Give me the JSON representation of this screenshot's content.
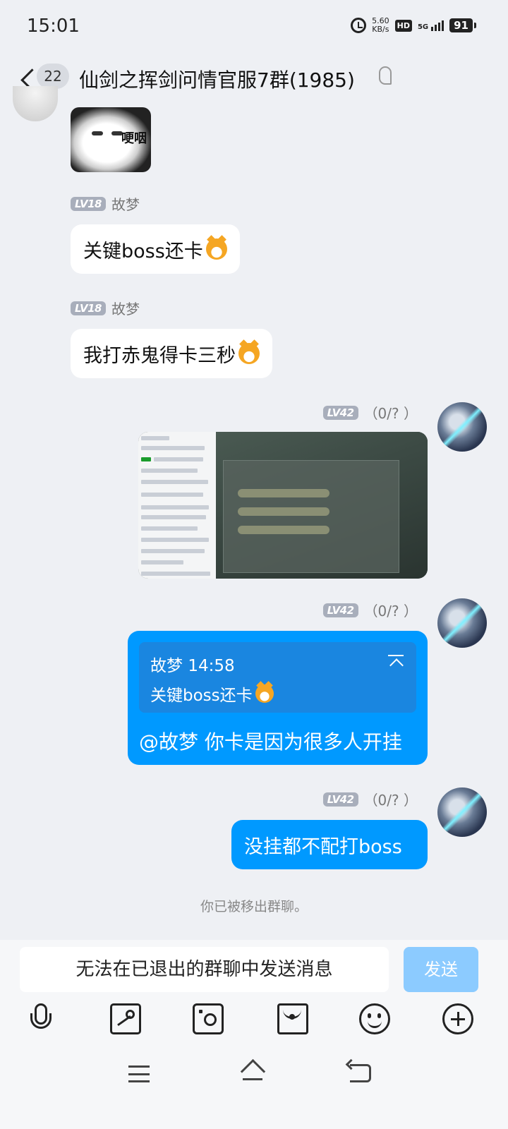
{
  "status_bar": {
    "time": "15:01",
    "net_speed_value": "5.60",
    "net_speed_unit": "KB/s",
    "hd": "HD",
    "network": "5G",
    "battery": "91"
  },
  "header": {
    "unread_count": "22",
    "title": "仙剑之挥剑问情官服7群(1985)"
  },
  "messages": [
    {
      "type": "sticker",
      "direction": "incoming",
      "sticker_text": "哽咽"
    },
    {
      "type": "text",
      "direction": "incoming",
      "level": "LV18",
      "sender": "故梦",
      "text": "关键boss还卡"
    },
    {
      "type": "text",
      "direction": "incoming",
      "level": "LV18",
      "sender": "故梦",
      "text": "我打赤鬼得卡三秒"
    },
    {
      "type": "image",
      "direction": "outgoing",
      "level": "LV42",
      "read_status": "（0/? ）"
    },
    {
      "type": "reply",
      "direction": "outgoing",
      "level": "LV42",
      "read_status": "（0/? ）",
      "quote": {
        "sender": "故梦",
        "time": "14:58",
        "text": "关键boss还卡"
      },
      "text": "@故梦 你卡是因为很多人开挂"
    },
    {
      "type": "text",
      "direction": "outgoing",
      "level": "LV42",
      "read_status": "（0/? ）",
      "text": "没挂都不配打boss"
    }
  ],
  "system_notice": "你已被移出群聊。",
  "input": {
    "placeholder": "无法在已退出的群聊中发送消息",
    "send_label": "发送"
  },
  "toolbar_icons": [
    "mic-icon",
    "image-icon",
    "camera-icon",
    "redpacket-icon",
    "emoji-icon",
    "plus-icon"
  ],
  "colors": {
    "background": "#eef0f4",
    "outgoing_bubble": "#0099ff",
    "send_button_disabled": "#8ccbff",
    "level_badge": "#a8aebb"
  }
}
